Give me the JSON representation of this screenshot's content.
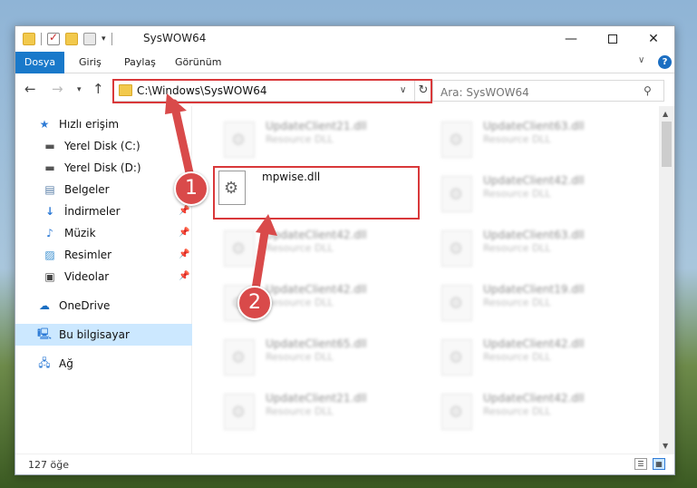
{
  "window": {
    "title": "SysWOW64"
  },
  "ribbon": {
    "tabs": [
      {
        "label": "Dosya",
        "active": true
      },
      {
        "label": "Giriş",
        "active": false
      },
      {
        "label": "Paylaş",
        "active": false
      },
      {
        "label": "Görünüm",
        "active": false
      }
    ],
    "help_label": "?"
  },
  "navbar": {
    "address": "C:\\Windows\\SysWOW64",
    "search_placeholder": "Ara: SysWOW64"
  },
  "sidebar": {
    "items": [
      {
        "label": "Hızlı erişim",
        "icon": "star-icon",
        "pinned": false,
        "selected": false
      },
      {
        "label": "Yerel Disk (C:)",
        "icon": "drive-icon",
        "pinned": false,
        "selected": false
      },
      {
        "label": "Yerel Disk (D:)",
        "icon": "drive-icon",
        "pinned": false,
        "selected": false
      },
      {
        "label": "Belgeler",
        "icon": "documents-icon",
        "pinned": true,
        "selected": false
      },
      {
        "label": "İndirmeler",
        "icon": "download-icon",
        "pinned": true,
        "selected": false
      },
      {
        "label": "Müzik",
        "icon": "music-icon",
        "pinned": true,
        "selected": false
      },
      {
        "label": "Resimler",
        "icon": "pictures-icon",
        "pinned": true,
        "selected": false
      },
      {
        "label": "Videolar",
        "icon": "videos-icon",
        "pinned": true,
        "selected": false
      },
      {
        "label": "OneDrive",
        "icon": "cloud-icon",
        "pinned": false,
        "selected": false
      },
      {
        "label": "Bu bilgisayar",
        "icon": "computer-icon",
        "pinned": false,
        "selected": true
      },
      {
        "label": "Ağ",
        "icon": "network-icon",
        "pinned": false,
        "selected": false
      }
    ]
  },
  "files": {
    "highlighted": {
      "name": "mpwise.dll"
    },
    "left_column": [
      {
        "name": "UpdateClient21.dll",
        "type": "Resource DLL"
      },
      {
        "name": "UpdateClient42.dll",
        "type": "Resource DLL"
      },
      {
        "name": "UpdateClient42.dll",
        "type": "Resource DLL"
      },
      {
        "name": "UpdateClient65.dll",
        "type": "Resource DLL"
      },
      {
        "name": "UpdateClient21.dll",
        "type": "Resource DLL"
      }
    ],
    "right_column": [
      {
        "name": "UpdateClient63.dll",
        "type": "Resource DLL"
      },
      {
        "name": "UpdateClient42.dll",
        "type": "Resource DLL"
      },
      {
        "name": "UpdateClient63.dll",
        "type": "Resource DLL"
      },
      {
        "name": "UpdateClient19.dll",
        "type": "Resource DLL"
      },
      {
        "name": "UpdateClient42.dll",
        "type": "Resource DLL"
      },
      {
        "name": "UpdateClient42.dll",
        "type": "Resource DLL"
      }
    ]
  },
  "status": {
    "item_count": "127 öğe"
  },
  "annotations": {
    "step1": "1",
    "step2": "2",
    "color": "#d9383a"
  }
}
